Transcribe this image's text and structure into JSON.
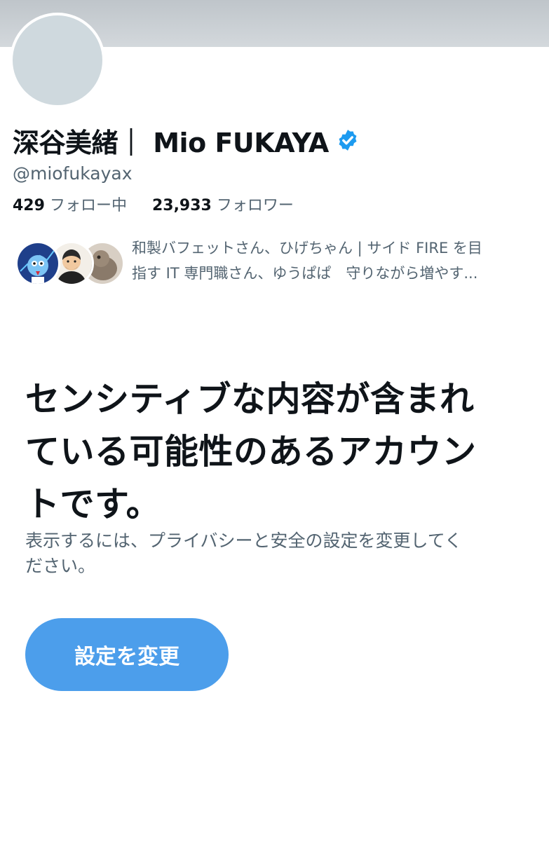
{
  "profile": {
    "display_name": "深谷美緒｜ Mio FUKAYA",
    "handle": "@miofukayax",
    "verified_icon": "verified-badge-icon",
    "following_count": "429",
    "following_label": "フォロー中",
    "followers_count": "23,933",
    "followers_label": "フォロワー"
  },
  "followed_by": {
    "avatars": [
      "followed-avatar-1",
      "followed-avatar-2",
      "followed-avatar-3"
    ],
    "line1": "和製バフェットさん、ひげちゃん | サイド FIRE を目",
    "line2": "指す IT 専門職さん、ゆうぱぱ　守りながら増やす..."
  },
  "warning": {
    "title_line1": "センシティブな内容が含まれ",
    "title_line2": "ている可能性のあるアカウン",
    "title_line3": "トです。",
    "body_line1": "表示するには、プライバシーと安全の設定を変更してく",
    "body_line2": "ださい。",
    "button_label": "設定を変更"
  },
  "colors": {
    "accent": "#4c9eeb",
    "verified": "#1d9bf0",
    "text_primary": "#0f1419",
    "text_secondary": "#536471"
  }
}
